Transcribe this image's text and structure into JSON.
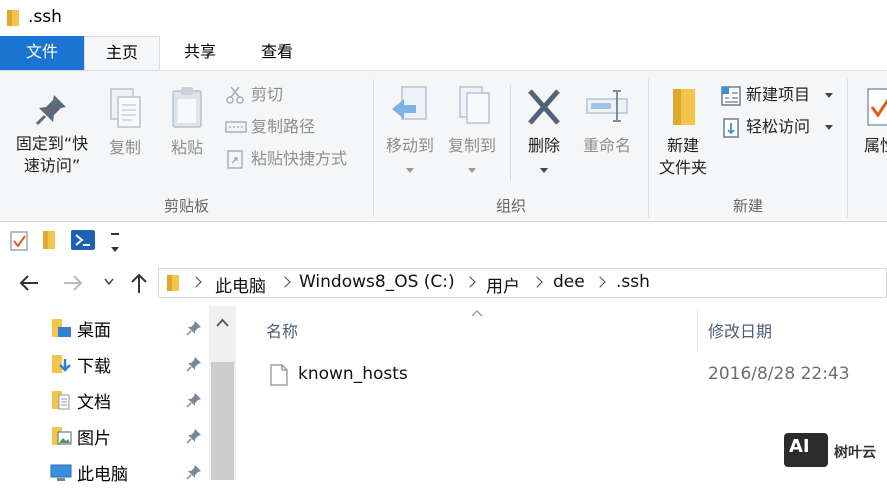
{
  "window": {
    "title": ".ssh"
  },
  "tabs": [
    {
      "label": "文件"
    },
    {
      "label": "主页"
    },
    {
      "label": "共享"
    },
    {
      "label": "查看"
    }
  ],
  "ribbon": {
    "clipboard": {
      "group_label": "剪贴板",
      "pin_line1": "固定到“快",
      "pin_line2": "速访问”",
      "copy": "复制",
      "paste": "粘贴",
      "cut": "剪切",
      "copy_path": "复制路径",
      "paste_shortcut": "粘贴快捷方式"
    },
    "organize": {
      "group_label": "组织",
      "move_to": "移动到",
      "copy_to": "复制到",
      "delete": "删除",
      "rename": "重命名"
    },
    "new": {
      "group_label": "新建",
      "new_folder_line1": "新建",
      "new_folder_line2": "文件夹",
      "new_item": "新建项目",
      "easy_access": "轻松访问"
    },
    "open": {
      "properties": "属性"
    }
  },
  "address": {
    "crumbs": [
      "此电脑",
      "Windows8_OS (C:)",
      "用户",
      "dee",
      ".ssh"
    ]
  },
  "nav_pane": {
    "items": [
      {
        "label": "桌面",
        "icon": "desktop-folder-icon"
      },
      {
        "label": "下载",
        "icon": "download-folder-icon"
      },
      {
        "label": "文档",
        "icon": "documents-folder-icon"
      },
      {
        "label": "图片",
        "icon": "pictures-folder-icon"
      },
      {
        "label": "此电脑",
        "icon": "computer-icon"
      }
    ]
  },
  "file_list": {
    "columns": {
      "name": "名称",
      "date": "修改日期"
    },
    "rows": [
      {
        "name": "known_hosts",
        "date": "2016/8/28 22:43"
      }
    ]
  },
  "watermark": {
    "badge": "AI",
    "text": "树叶云"
  },
  "colors": {
    "file_tab": "#1a74d1",
    "ribbon_bg": "#f5f6f7",
    "folder_yellow": "#f3c64b"
  }
}
